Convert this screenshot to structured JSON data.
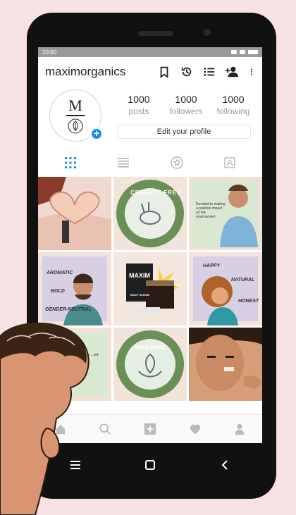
{
  "statusbar": {
    "time": "20:00"
  },
  "header": {
    "username": "maximorganics"
  },
  "profile": {
    "avatar_logo": "M",
    "add_badge": "+",
    "stats": [
      {
        "value": "1000",
        "label": "posts"
      },
      {
        "value": "1000",
        "label": "followers"
      },
      {
        "value": "1000",
        "label": "following"
      }
    ],
    "edit_button": "Edit your profile"
  },
  "posts": {
    "cruelty_text": "CRUELTY FREE",
    "impact_text": "Devoted to making a positive impact on the environment",
    "product_text": "MAXIM",
    "product_subtext": "BODY SCRUB",
    "aromatic_text": "AROMATIC",
    "bold_text": "BOLD",
    "gender_text": "GENDER-NEUTRAL",
    "happy_text": "HAPPY",
    "natural_text": "NATURAL",
    "honest_text": "HONEST",
    "organic_text": "ORGANIC",
    "words_text": "ur words ...ied after"
  },
  "colors": {
    "accent": "#1a8de9",
    "background": "#f8e3e4",
    "phone": "#111111",
    "muted_text": "#9a9a9a"
  }
}
